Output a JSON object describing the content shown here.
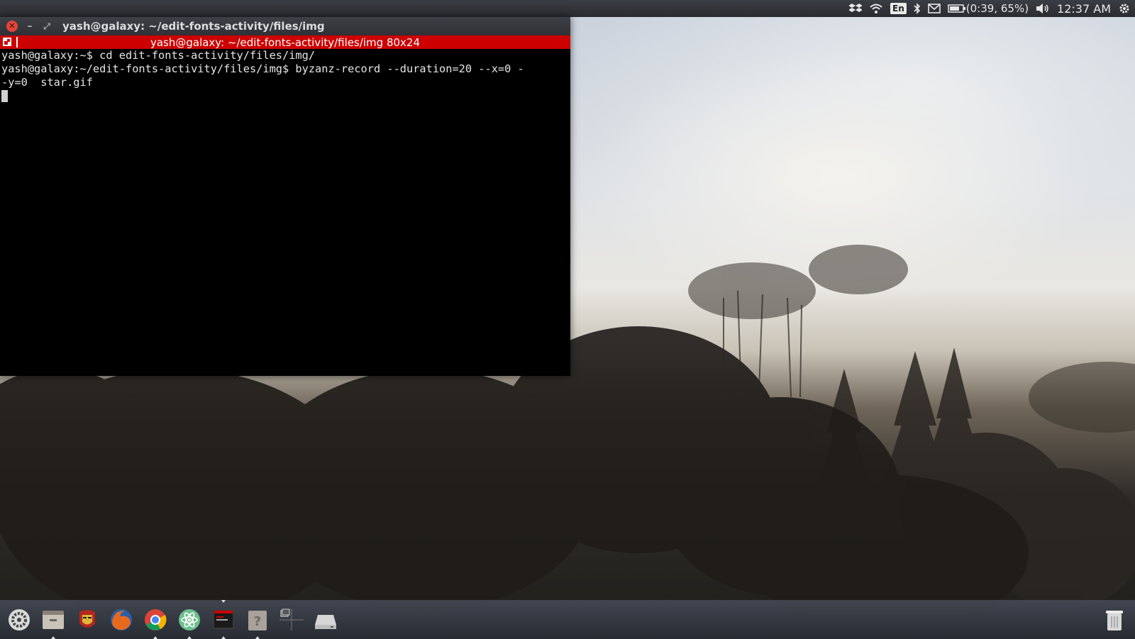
{
  "top_panel": {
    "keyboard_language": "En",
    "battery_status": "(0:39, 65%)",
    "clock": "12:37 AM",
    "icons": [
      "dropbox-icon",
      "wifi-icon",
      "keyboard-language-indicator",
      "bluetooth-icon",
      "mail-icon",
      "battery-icon",
      "volume-icon",
      "settings-gear-icon"
    ]
  },
  "terminal_window": {
    "title": "yash@galaxy: ~/edit-fonts-activity/files/img",
    "header_title": "yash@galaxy: ~/edit-fonts-activity/files/img 80x24",
    "header_color": "#cc0000",
    "lines": [
      "yash@galaxy:~$ cd edit-fonts-activity/files/img/",
      "yash@galaxy:~/edit-fonts-activity/files/img$ byzanz-record --duration=20 --x=0 -",
      "-y=0  star.gif"
    ]
  },
  "dock": {
    "items": [
      {
        "name": "system-settings-icon"
      },
      {
        "name": "file-manager-icon"
      },
      {
        "name": "ironman-app-icon"
      },
      {
        "name": "firefox-icon"
      },
      {
        "name": "chrome-icon"
      },
      {
        "name": "atom-editor-icon"
      },
      {
        "name": "terminal-icon"
      },
      {
        "name": "help-icon"
      },
      {
        "name": "workspace-switcher-icon"
      },
      {
        "name": "drive-icon"
      },
      {
        "name": "trash-icon"
      }
    ]
  },
  "colors": {
    "panel": "#2b2c31",
    "terminal_bg": "#000000",
    "terminal_fg": "#e6e6e6",
    "accent_red": "#cc0000"
  }
}
